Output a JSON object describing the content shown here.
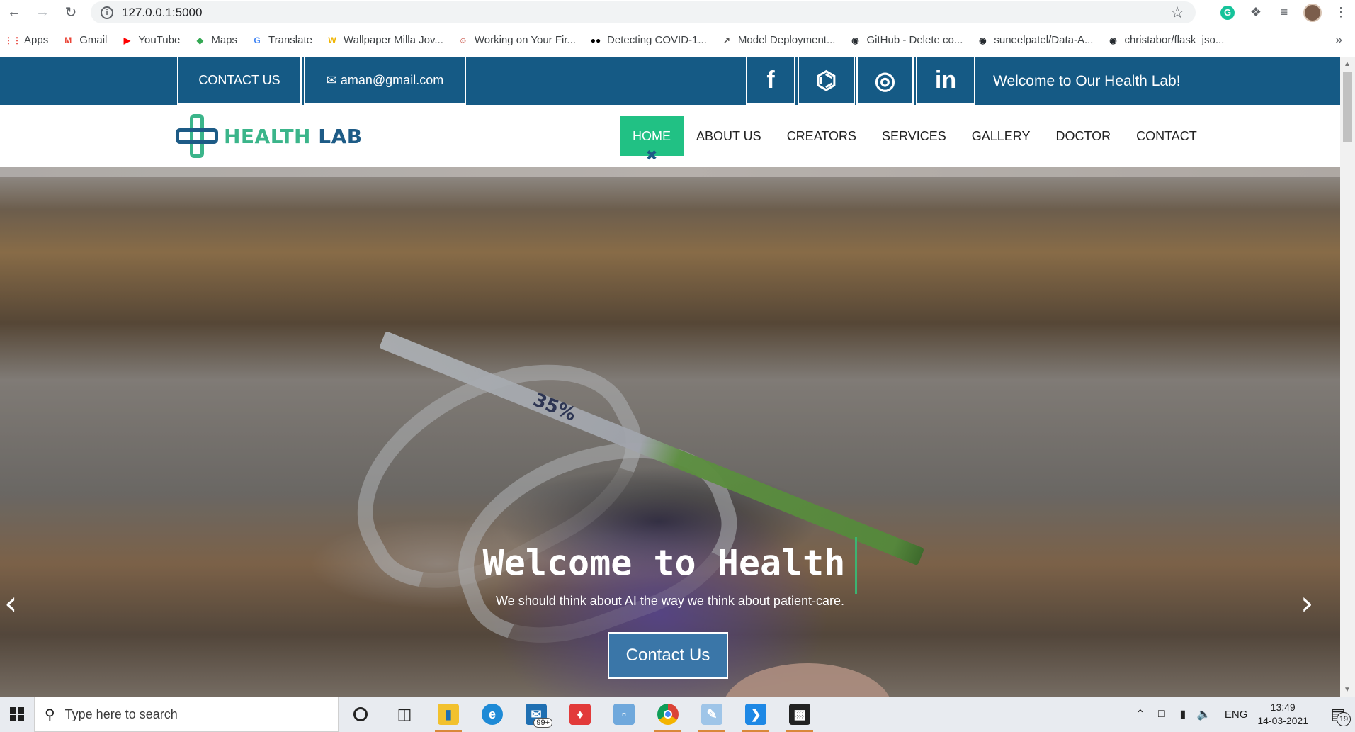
{
  "browser": {
    "url": "127.0.0.1:5000",
    "bookmarks": [
      {
        "label": "Apps",
        "icon": "apps-grid-icon",
        "color": "#e8453c"
      },
      {
        "label": "Gmail",
        "icon": "gmail-icon",
        "color": "#ea4335"
      },
      {
        "label": "YouTube",
        "icon": "youtube-icon",
        "color": "#ff0000"
      },
      {
        "label": "Maps",
        "icon": "maps-icon",
        "color": "#34a853"
      },
      {
        "label": "Translate",
        "icon": "translate-icon",
        "color": "#4285f4"
      },
      {
        "label": "Wallpaper Milla Jov...",
        "icon": "wallpaper-icon",
        "color": "#f0b400"
      },
      {
        "label": "Working on Your Fir...",
        "icon": "avatar-icon",
        "color": "#c0392b"
      },
      {
        "label": "Detecting COVID-1...",
        "icon": "medium-icon",
        "color": "#000000"
      },
      {
        "label": "Model Deployment...",
        "icon": "chart-line-icon",
        "color": "#555555"
      },
      {
        "label": "GitHub - Delete co...",
        "icon": "github-icon",
        "color": "#24292e"
      },
      {
        "label": "suneelpatel/Data-A...",
        "icon": "github-icon",
        "color": "#24292e"
      },
      {
        "label": "christabor/flask_jso...",
        "icon": "github-icon",
        "color": "#24292e"
      }
    ],
    "more": "»"
  },
  "topbar": {
    "contact_label": "CONTACT US",
    "email": "aman@gmail.com",
    "welcome": "Welcome to Our Health Lab!",
    "social": [
      "f",
      "⌬",
      "◎",
      "in"
    ]
  },
  "logo": {
    "part1": "HEALTH",
    "part2": " LAB"
  },
  "menu": [
    "HOME",
    "ABOUT US",
    "CREATORS",
    "SERVICES",
    "GALLERY",
    "DOCTOR",
    "CONTACT"
  ],
  "hero": {
    "title": "Welcome to Health",
    "subtitle": "We should think about AI the way we think about patient-care.",
    "button": "Contact Us",
    "syringe_label": "35%",
    "prev": "‹",
    "next": "›"
  },
  "taskbar": {
    "search_placeholder": "Type here to search",
    "mail_badge": "99+",
    "lang": "ENG",
    "time": "13:49",
    "date": "14-03-2021",
    "notifications": "19"
  },
  "colors": {
    "topbar": "#155a85",
    "active_menu": "#21c184",
    "logo_green": "#3bb58a",
    "logo_blue": "#1d5b86",
    "hero_button": "#3a76a8"
  }
}
